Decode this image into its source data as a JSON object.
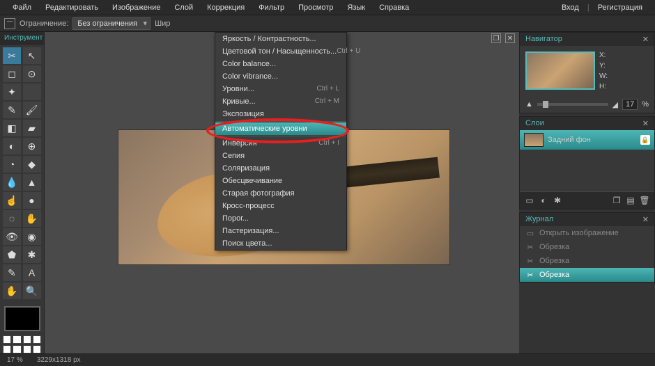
{
  "menubar": {
    "items": [
      "Файл",
      "Редактировать",
      "Изображение",
      "Слой",
      "Коррекция",
      "Фильтр",
      "Просмотр",
      "Язык",
      "Справка"
    ],
    "login": "Вход",
    "register": "Регистрация"
  },
  "optionbar": {
    "constraint_label": "Ограничение:",
    "constraint_value": "Без ограничения",
    "width_label": "Шир"
  },
  "toolbox": {
    "title": "Инструмент"
  },
  "dropdown": {
    "items": [
      {
        "label": "Яркость / Контрастность...",
        "shortcut": ""
      },
      {
        "label": "Цветовой тон / Насыщенность...",
        "shortcut": "Ctrl + U"
      },
      {
        "label": "Color balance...",
        "shortcut": ""
      },
      {
        "label": "Color vibrance...",
        "shortcut": ""
      },
      {
        "label": "Уровни...",
        "shortcut": "Ctrl + L"
      },
      {
        "label": "Кривые...",
        "shortcut": "Ctrl + M"
      },
      {
        "label": "Экспозиция",
        "shortcut": ""
      }
    ],
    "highlighted": {
      "label": "Автоматические уровни",
      "shortcut": ""
    },
    "items2": [
      {
        "label": "Инверсия",
        "shortcut": "Ctrl + I"
      },
      {
        "label": "Сепия",
        "shortcut": ""
      },
      {
        "label": "Соляризация",
        "shortcut": ""
      },
      {
        "label": "Обесцвечивание",
        "shortcut": ""
      },
      {
        "label": "Старая фотография",
        "shortcut": ""
      },
      {
        "label": "Кросс-процесс",
        "shortcut": ""
      },
      {
        "label": "Порог...",
        "shortcut": ""
      },
      {
        "label": "Пастеризация...",
        "shortcut": ""
      },
      {
        "label": "Поиск цвета...",
        "shortcut": ""
      }
    ]
  },
  "navigator": {
    "title": "Навигатор",
    "labels": {
      "x": "X:",
      "y": "Y:",
      "w": "W:",
      "h": "H:"
    },
    "zoom": "17",
    "pct": "%"
  },
  "layers": {
    "title": "Слои",
    "bg": "Задний фон"
  },
  "history": {
    "title": "Журнал",
    "items": [
      {
        "label": "Открыть изображение"
      },
      {
        "label": "Обрезка"
      },
      {
        "label": "Обрезка"
      },
      {
        "label": "Обрезка"
      }
    ]
  },
  "status": {
    "zoom": "17",
    "pct": "%",
    "dims": "3229x1318 px"
  }
}
